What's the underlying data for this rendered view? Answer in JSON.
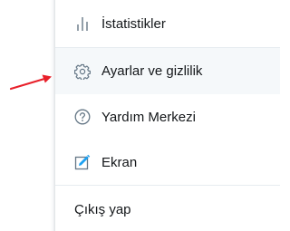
{
  "menu": {
    "items": [
      {
        "label": "İstatistikler",
        "icon": "bar-chart-icon"
      },
      {
        "label": "Ayarlar ve gizlilik",
        "icon": "gear-icon",
        "state": "hovered"
      },
      {
        "label": "Yardım Merkezi",
        "icon": "help-circle-icon"
      },
      {
        "label": "Ekran",
        "icon": "display-edit-icon"
      }
    ],
    "logout_label": "Çıkış yap"
  },
  "annotation": {
    "icon": "red-arrow-icon",
    "color": "#e8202a"
  },
  "colors": {
    "text": "#14171a",
    "icon": "#657786",
    "accent": "#1da1f2",
    "hover_bg": "#f5f8fa",
    "divider": "#e6ecf0"
  }
}
